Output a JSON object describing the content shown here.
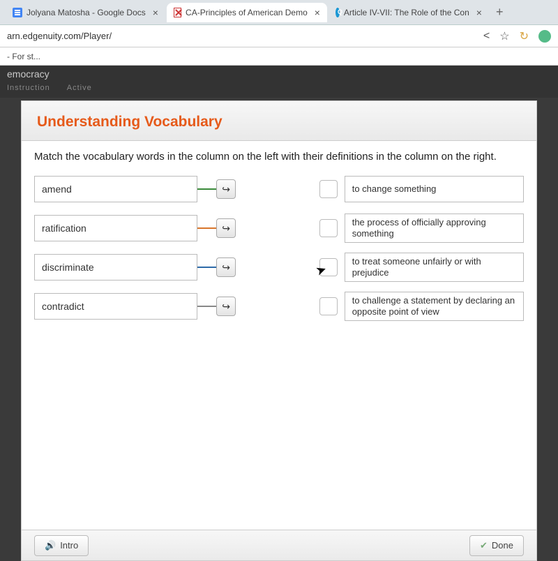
{
  "browser": {
    "tabs": [
      {
        "title": "Jolyana Matosha - Google Docs",
        "active": false
      },
      {
        "title": "CA-Principles of American Demo",
        "active": true
      },
      {
        "title": "Article IV-VII: The Role of the Con",
        "active": false
      }
    ],
    "address": "arn.edgenuity.com/Player/",
    "bookmark": "- For st..."
  },
  "appHeader": {
    "crumb": "emocracy",
    "sub1": "Instruction",
    "sub2": "Active"
  },
  "panel": {
    "title": "Understanding Vocabulary",
    "instruction": "Match the vocabulary words in the column on the left with their definitions in the column on the right.",
    "terms": [
      "amend",
      "ratification",
      "discriminate",
      "contradict"
    ],
    "definitions": [
      "to change something",
      "the process of officially approving something",
      "to treat someone unfairly or with prejudice",
      "to challenge a statement by declaring an opposite point of view"
    ],
    "connectorClasses": [
      "c-green",
      "c-orange",
      "c-blue",
      "c-gray"
    ],
    "introLabel": "Intro",
    "doneLabel": "Done"
  }
}
